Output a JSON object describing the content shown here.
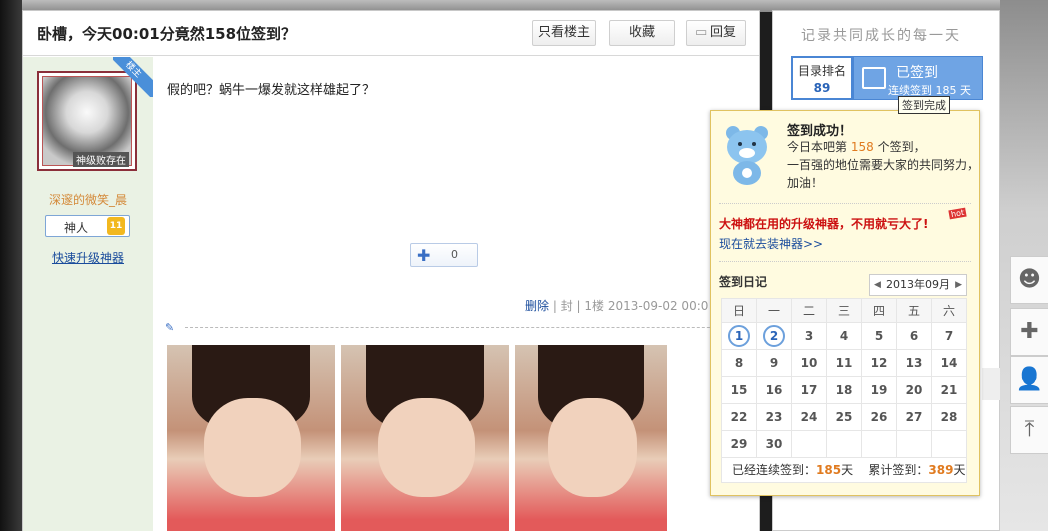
{
  "thread": {
    "title": "卧槽，今天00:01分竟然158位签到？",
    "buttons": {
      "only_owner": "只看楼主",
      "favorite": "收藏",
      "reply": "回复"
    }
  },
  "author": {
    "badge": "楼主",
    "avatar_tag": "神级败存在",
    "name": "深邃的微笑_晨",
    "level_name": "神人",
    "level_num": "11",
    "upgrade_link": "快速升级神器"
  },
  "post": {
    "text": "假的吧？蜗牛一爆发就这样雄起了？",
    "like_count": "0",
    "delete": "删除",
    "ban": "封",
    "floor": "1楼",
    "time": "2013-09-02 00:0"
  },
  "side": {
    "slogan": "记录共同成长的每一天",
    "rank_label": "目录排名",
    "rank_value": "89",
    "signed_label": "已签到",
    "signed_sub": "连续签到 185 天",
    "tooltip": "签到完成"
  },
  "popup": {
    "title": "签到成功！",
    "line1_pre": "今日本吧第",
    "line1_num": "158",
    "line1_post": "个签到，",
    "line2": "一百强的地位需要大家的共同努力，",
    "line3": "加油！",
    "promo": "大神都在用的升级神器，不用就亏大了!",
    "hot": "hot",
    "promo_link": "现在就去装神器>>",
    "diary_title": "签到日记",
    "month": "2013年09月",
    "weekdays": [
      "日",
      "一",
      "二",
      "三",
      "四",
      "五",
      "六"
    ],
    "weeks": [
      [
        "1",
        "2",
        "3",
        "4",
        "5",
        "6",
        "7"
      ],
      [
        "8",
        "9",
        "10",
        "11",
        "12",
        "13",
        "14"
      ],
      [
        "15",
        "16",
        "17",
        "18",
        "19",
        "20",
        "21"
      ],
      [
        "22",
        "23",
        "24",
        "25",
        "26",
        "27",
        "28"
      ],
      [
        "29",
        "30",
        "",
        "",
        "",
        "",
        ""
      ]
    ],
    "signed_days": [
      "1",
      "2"
    ],
    "streak_label": "已经连续签到：",
    "streak_value": "185",
    "total_label": "累计签到：",
    "total_value": "389",
    "day_unit": "天"
  }
}
